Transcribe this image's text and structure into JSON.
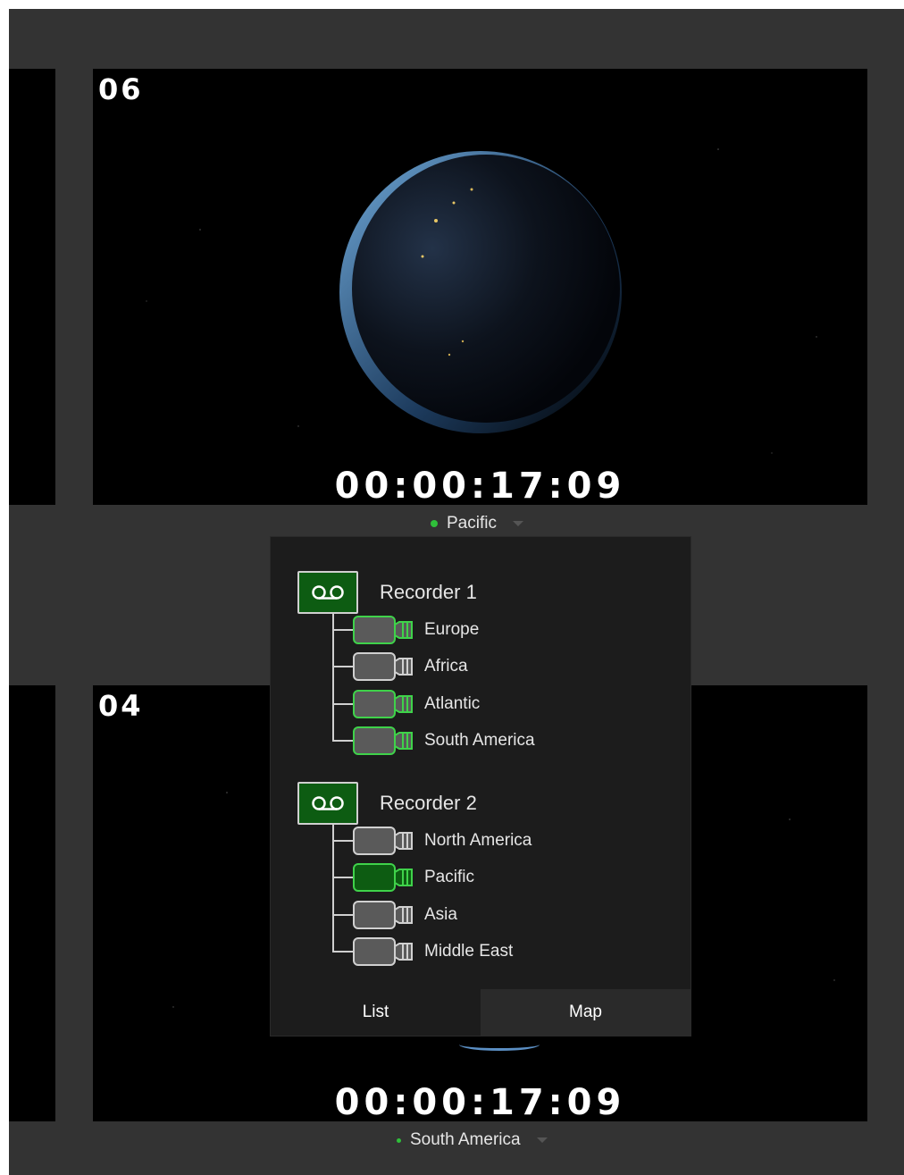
{
  "feeds": [
    {
      "number": "06",
      "timecode": "00:00:17:09",
      "source": "Pacific"
    },
    {
      "number": "04",
      "timecode": "00:00:17:09",
      "source": "South America"
    }
  ],
  "popup": {
    "recorders": [
      {
        "label": "Recorder 1",
        "cameras": [
          {
            "label": "Europe",
            "state": "active"
          },
          {
            "label": "Africa",
            "state": "inactive"
          },
          {
            "label": "Atlantic",
            "state": "active"
          },
          {
            "label": "South America",
            "state": "active"
          }
        ]
      },
      {
        "label": "Recorder 2",
        "cameras": [
          {
            "label": "North America",
            "state": "inactive"
          },
          {
            "label": "Pacific",
            "state": "selected"
          },
          {
            "label": "Asia",
            "state": "inactive"
          },
          {
            "label": "Middle East",
            "state": "inactive"
          }
        ]
      }
    ],
    "tabs": {
      "list": "List",
      "map": "Map"
    }
  },
  "colors": {
    "background": "#333333",
    "accent_green": "#2fbf3a",
    "recorder_green": "#0d5c12",
    "popup_bg": "#1c1c1c"
  }
}
